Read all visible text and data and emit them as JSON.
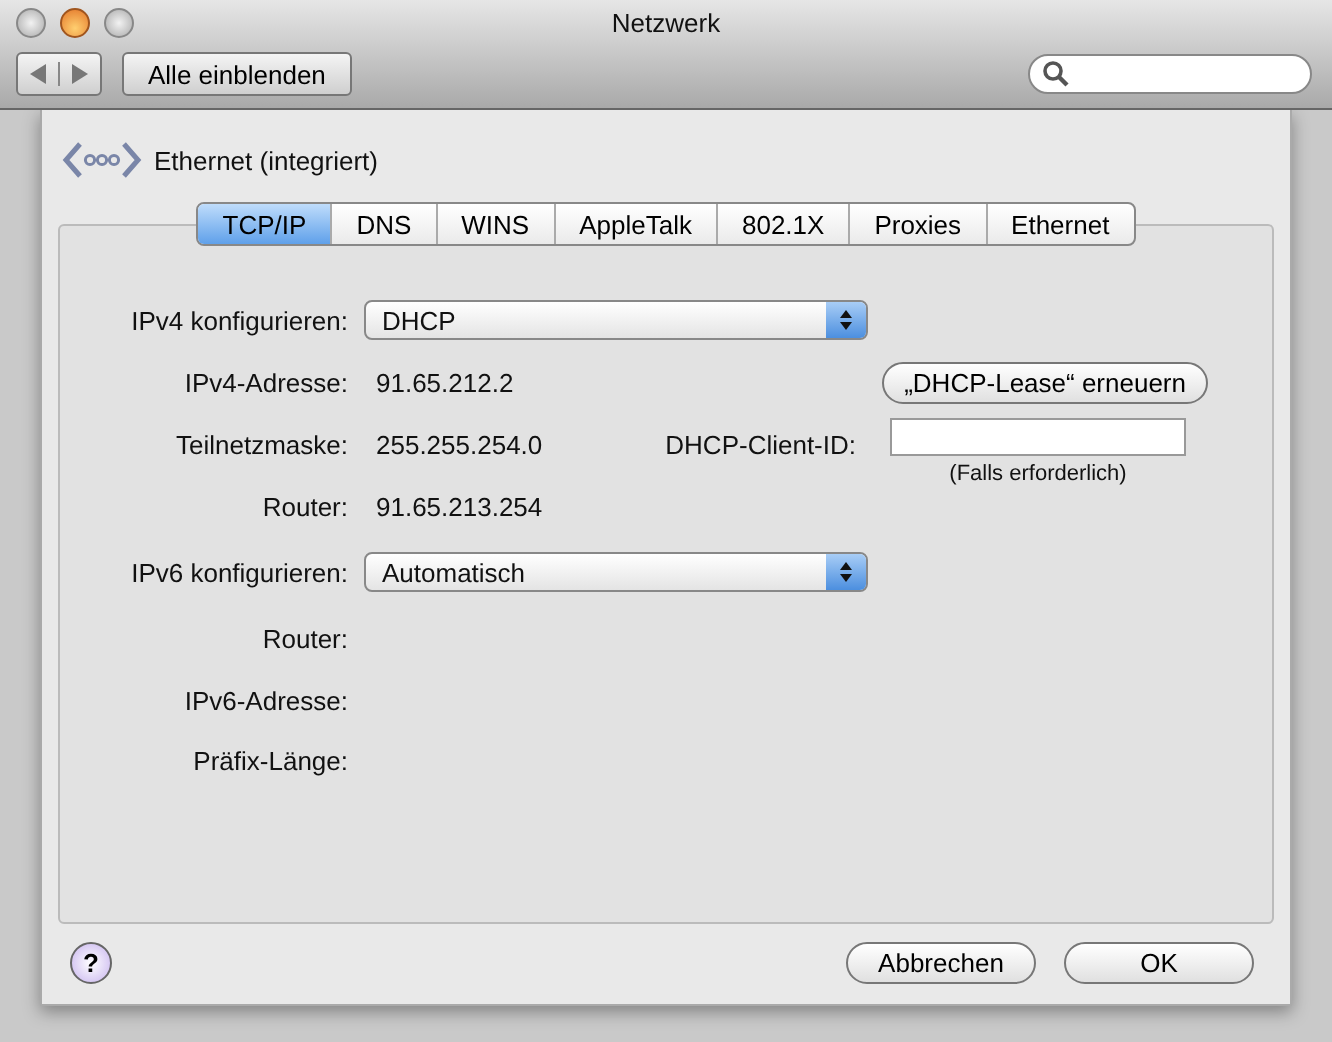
{
  "window": {
    "title": "Netzwerk"
  },
  "toolbar": {
    "show_all_button": "Alle einblenden"
  },
  "sheet": {
    "interface": "Ethernet (integriert)",
    "tabs": [
      {
        "label": "TCP/IP",
        "selected": true
      },
      {
        "label": "DNS",
        "selected": false
      },
      {
        "label": "WINS",
        "selected": false
      },
      {
        "label": "AppleTalk",
        "selected": false
      },
      {
        "label": "802.1X",
        "selected": false
      },
      {
        "label": "Proxies",
        "selected": false
      },
      {
        "label": "Ethernet",
        "selected": false
      }
    ],
    "fields": [
      {
        "kind": "popup",
        "label": "IPv4 konfigurieren:",
        "value": "DHCP"
      },
      {
        "kind": "text",
        "label": "IPv4-Adresse:",
        "value": "91.65.212.2"
      },
      {
        "kind": "text",
        "label": "Teilnetzmaske:",
        "value": "255.255.254.0"
      },
      {
        "kind": "text",
        "label": "Router:",
        "value": "91.65.213.254"
      },
      {
        "kind": "popup",
        "label": "IPv6 konfigurieren:",
        "value": "Automatisch"
      },
      {
        "kind": "text",
        "label": "Router:"
      },
      {
        "kind": "text",
        "label": "IPv6-Adresse:"
      },
      {
        "kind": "text",
        "label": "Präfix-Länge:"
      }
    ],
    "renew_lease_button": "„DHCP-Lease“ erneuern",
    "client_id": {
      "label": "DHCP-Client-ID:",
      "hint": "(Falls erforderlich)"
    },
    "help_button": "?",
    "buttons": [
      "Abbrechen",
      "OK"
    ]
  }
}
